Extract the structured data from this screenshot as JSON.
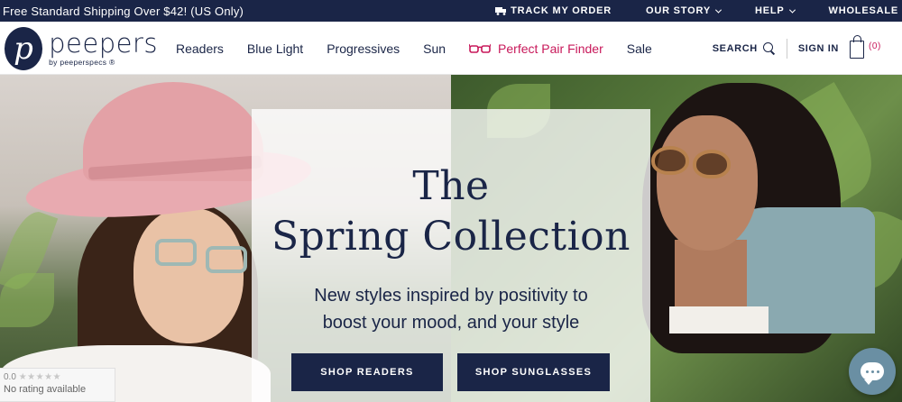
{
  "topbar": {
    "promo": "Free Standard Shipping Over $42! (US Only)",
    "track_label": "TRACK MY ORDER",
    "our_story_label": "OUR STORY",
    "help_label": "HELP",
    "wholesale_label": "WHOLESALE"
  },
  "brand": {
    "logo_letter": "p",
    "name": "peepers",
    "tagline": "by peeperspecs ®"
  },
  "nav": {
    "items": [
      "Readers",
      "Blue Light",
      "Progressives",
      "Sun"
    ],
    "perfect_pair_label": "Perfect Pair Finder",
    "sale_label": "Sale"
  },
  "header": {
    "search_label": "SEARCH",
    "signin_label": "SIGN IN",
    "cart_count": "(0)"
  },
  "hero": {
    "title_line1": "The",
    "title_line2": "Spring Collection",
    "subtitle_line1": "New styles inspired by positivity to",
    "subtitle_line2": "boost your mood, and your style",
    "button_readers": "SHOP READERS",
    "button_sunglasses": "SHOP SUNGLASSES"
  },
  "rating_widget": {
    "score": "0.0",
    "stars": "★★★★★",
    "text": "No rating available"
  },
  "colors": {
    "navy": "#1a2547",
    "accent_pink": "#c8185a",
    "chat_blue": "#6a8fa3"
  }
}
